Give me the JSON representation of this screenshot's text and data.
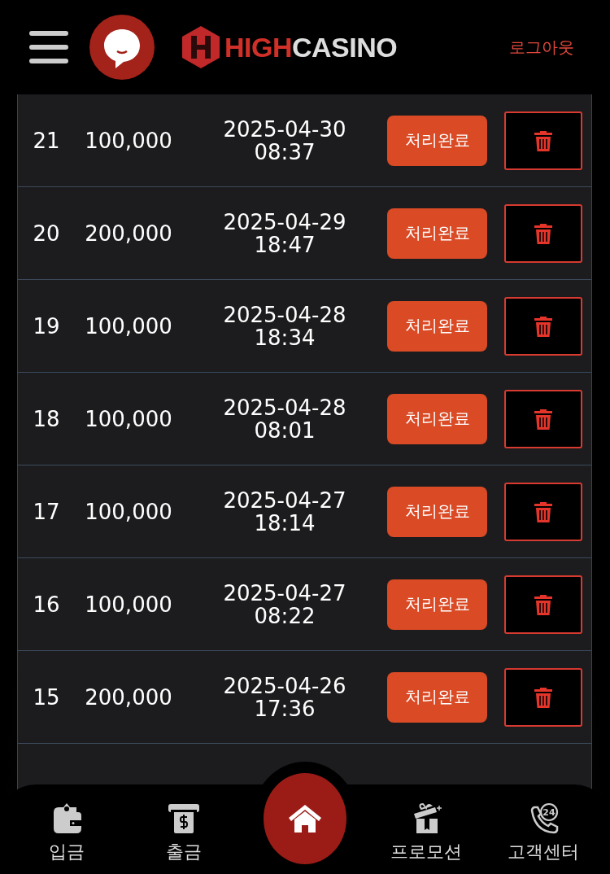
{
  "header": {
    "logo_high": "HIGH",
    "logo_casino": "CASINO",
    "logout": "로그아웃"
  },
  "rows": [
    {
      "number": "21",
      "amount": "100,000",
      "date": "2025-04-30",
      "time": "08:37",
      "status": "처리완료"
    },
    {
      "number": "20",
      "amount": "200,000",
      "date": "2025-04-29",
      "time": "18:47",
      "status": "처리완료"
    },
    {
      "number": "19",
      "amount": "100,000",
      "date": "2025-04-28",
      "time": "18:34",
      "status": "처리완료"
    },
    {
      "number": "18",
      "amount": "100,000",
      "date": "2025-04-28",
      "time": "08:01",
      "status": "처리완료"
    },
    {
      "number": "17",
      "amount": "100,000",
      "date": "2025-04-27",
      "time": "18:14",
      "status": "처리완료"
    },
    {
      "number": "16",
      "amount": "100,000",
      "date": "2025-04-27",
      "time": "08:22",
      "status": "처리완료"
    },
    {
      "number": "15",
      "amount": "200,000",
      "date": "2025-04-26",
      "time": "17:36",
      "status": "처리완료"
    }
  ],
  "nav": [
    {
      "kind": "wallet",
      "label": "입금"
    },
    {
      "kind": "atm",
      "label": "출금"
    },
    {
      "kind": "home"
    },
    {
      "kind": "gift",
      "label": "프로모션"
    },
    {
      "kind": "support",
      "label": "고객센터",
      "badge": "24"
    }
  ]
}
